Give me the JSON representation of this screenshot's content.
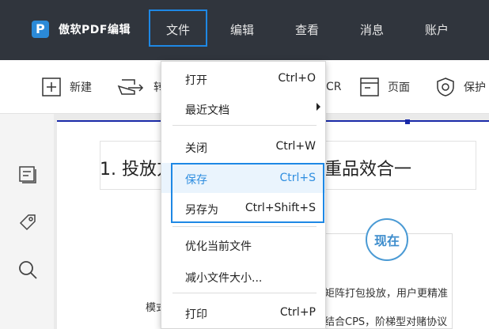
{
  "app": {
    "name": "傲软PDF编辑"
  },
  "menubar": {
    "items": [
      "文件",
      "编辑",
      "查看",
      "消息",
      "账户"
    ]
  },
  "toolbar": {
    "new_label": "新建",
    "convert_label": "转",
    "ocr_label": "CR",
    "page_label": "页面",
    "protect_label": "保护"
  },
  "document": {
    "title_left": "1. 投放方",
    "title_right": "重品效合一",
    "stamp_text": "现在",
    "lines": [
      "矩阵打包投放，用户更精准",
      "结合CPS，阶梯型对赌协议",
      "模式"
    ]
  },
  "file_menu": {
    "items": [
      {
        "label": "打开",
        "shortcut": "Ctrl+O"
      },
      {
        "label": "最近文档",
        "shortcut": ""
      },
      {
        "label": "关闭",
        "shortcut": "Ctrl+W"
      },
      {
        "label": "保存",
        "shortcut": "Ctrl+S"
      },
      {
        "label": "另存为",
        "shortcut": "Ctrl+Shift+S"
      },
      {
        "label": "优化当前文件",
        "shortcut": ""
      },
      {
        "label": "减小文件大小...",
        "shortcut": ""
      },
      {
        "label": "打印",
        "shortcut": "Ctrl+P"
      }
    ]
  },
  "colors": {
    "topbar": "#30353d",
    "accent": "#1e88e5",
    "save_text": "#2f8ee0"
  }
}
